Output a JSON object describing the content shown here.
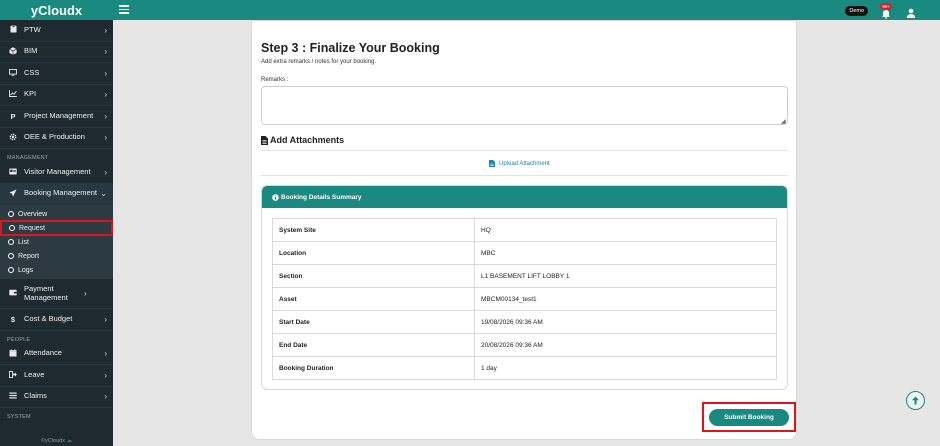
{
  "app": {
    "brand": "yCloudx",
    "footer": "©yCloudx"
  },
  "topbar": {
    "demo_label": "Demo",
    "notification_count": "99+"
  },
  "sidebar": {
    "items_top": [
      {
        "label": "PTW",
        "icon": "clipboard-icon"
      },
      {
        "label": "BIM",
        "icon": "cube-icon"
      },
      {
        "label": "CSS",
        "icon": "monitor-icon"
      },
      {
        "label": "KPI",
        "icon": "chart-line-icon"
      },
      {
        "label": "Project Management",
        "icon": "parking-icon"
      },
      {
        "label": "OEE & Production",
        "icon": "gear-icon"
      }
    ],
    "section_management": "MANAGEMENT",
    "visitor": {
      "label": "Visitor Management"
    },
    "booking": {
      "label": "Booking Management"
    },
    "booking_sub": [
      "Overview",
      "Request",
      "List",
      "Report",
      "Logs"
    ],
    "payment": {
      "label": "Payment Management"
    },
    "cost": {
      "label": "Cost & Budget"
    },
    "section_people": "PEOPLE",
    "people": [
      {
        "label": "Attendance"
      },
      {
        "label": "Leave"
      },
      {
        "label": "Claims"
      }
    ],
    "section_system": "SYSTEM"
  },
  "form": {
    "title": "Step 3 : Finalize Your Booking",
    "subtitle": "Add extra remarks / notes for your booking.",
    "remarks_label": "Remarks :",
    "remarks_value": "",
    "attachments_title": "Add Attachments",
    "upload_label": "Upload Attachment"
  },
  "summary": {
    "title": "Booking Details Summary",
    "rows": [
      {
        "key": "System Site",
        "value": "HQ"
      },
      {
        "key": "Location",
        "value": "MBC"
      },
      {
        "key": "Section",
        "value": "L1 BASEMENT LIFT LOBBY 1"
      },
      {
        "key": "Asset",
        "value": "MBCM00134_test1"
      },
      {
        "key": "Start Date",
        "value": "19/08/2026 09:36 AM"
      },
      {
        "key": "End Date",
        "value": "20/08/2026 09:36 AM"
      },
      {
        "key": "Booking Duration",
        "value": "1 day"
      }
    ]
  },
  "actions": {
    "submit_label": "Submit Booking"
  },
  "colors": {
    "brand": "#1a8a80",
    "sidebar": "#1e2a30",
    "highlight": "#e0131b",
    "link": "#1a84b8"
  }
}
